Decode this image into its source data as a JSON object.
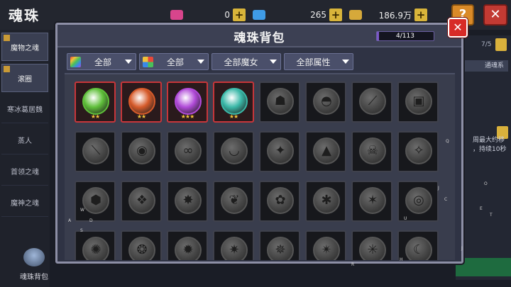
{
  "screen": {
    "title": "魂珠",
    "resources": [
      {
        "name": "pink-gem",
        "value": "0",
        "color": "#d8458c"
      },
      {
        "name": "blue-gem",
        "value": "265",
        "color": "#3f9be6"
      },
      {
        "name": "gold-chest",
        "value": "186.9万",
        "color": "#d6a93a"
      }
    ],
    "help_label": "?",
    "close_label": "✕"
  },
  "sidebar": {
    "items": [
      {
        "label": "魔物之魂",
        "active": true
      },
      {
        "label": "滚圈",
        "active": true
      },
      {
        "label": "寒冰葛居魏",
        "active": false
      },
      {
        "label": "蒸人",
        "active": false
      },
      {
        "label": "首领之魂",
        "active": false
      },
      {
        "label": "魔神之魂",
        "active": false
      }
    ],
    "bag_label": "魂珠背包"
  },
  "right_panel": {
    "count": "7/5",
    "tab": "通魂系",
    "text_line1": "周最大约移",
    "text_line2": "，持续10秒"
  },
  "modal": {
    "title": "魂珠背包",
    "capacity": {
      "text": "4/113",
      "used": 4,
      "total": 113
    },
    "close_label": "✕",
    "filters": [
      {
        "label": "全部",
        "icon": "rainbow-icon"
      },
      {
        "label": "全部",
        "icon": "color-grid-icon"
      },
      {
        "label": "全部魔女",
        "icon": ""
      },
      {
        "label": "全部属性",
        "icon": ""
      }
    ],
    "slots": [
      {
        "owned": true,
        "stars": 2,
        "icon": "green-rune-orb",
        "color": "#5fbf3a"
      },
      {
        "owned": true,
        "stars": 2,
        "icon": "fire-claw-orb",
        "color": "#d65a2a"
      },
      {
        "owned": true,
        "stars": 3,
        "icon": "purple-crystal-orb",
        "color": "#b04ad8"
      },
      {
        "owned": true,
        "stars": 2,
        "icon": "teal-gem-orb",
        "color": "#3ab8a8"
      },
      {
        "owned": false,
        "icon": "mask-orb",
        "glyph": "☗"
      },
      {
        "owned": false,
        "icon": "bird-orb",
        "glyph": "◓"
      },
      {
        "owned": false,
        "icon": "blade-orb",
        "glyph": "⟋"
      },
      {
        "owned": false,
        "icon": "cube-orb",
        "glyph": "▣"
      },
      {
        "owned": false,
        "icon": "sword-orb",
        "glyph": "⟍"
      },
      {
        "owned": false,
        "icon": "dragon-orb",
        "glyph": "◉"
      },
      {
        "owned": false,
        "icon": "serpent-orb",
        "glyph": "∞"
      },
      {
        "owned": false,
        "icon": "wing-orb",
        "glyph": "◡"
      },
      {
        "owned": false,
        "icon": "beast-orb",
        "glyph": "✦"
      },
      {
        "owned": false,
        "icon": "hat-orb",
        "glyph": "▲"
      },
      {
        "owned": false,
        "icon": "skull-orb",
        "glyph": "☠"
      },
      {
        "owned": false,
        "icon": "spear-orb",
        "glyph": "✧"
      },
      {
        "owned": false,
        "icon": "dog-orb",
        "glyph": "⬢"
      },
      {
        "owned": false,
        "icon": "crest-orb",
        "glyph": "❖"
      },
      {
        "owned": false,
        "icon": "spike-orb",
        "glyph": "✸"
      },
      {
        "owned": false,
        "icon": "leaf-orb",
        "glyph": "❦"
      },
      {
        "owned": false,
        "icon": "flower-orb",
        "glyph": "✿"
      },
      {
        "owned": false,
        "icon": "claw-orb",
        "glyph": "✱"
      },
      {
        "owned": false,
        "icon": "wolf-orb",
        "glyph": "✶"
      },
      {
        "owned": false,
        "icon": "ring-orb",
        "glyph": "◎"
      },
      {
        "owned": false,
        "icon": "gear-orb",
        "glyph": "✺"
      },
      {
        "owned": false,
        "icon": "mech-orb",
        "glyph": "❂"
      },
      {
        "owned": false,
        "icon": "bat-orb",
        "glyph": "✹"
      },
      {
        "owned": false,
        "icon": "fish-orb",
        "glyph": "✷"
      },
      {
        "owned": false,
        "icon": "branch-orb",
        "glyph": "✵"
      },
      {
        "owned": false,
        "icon": "talon-orb",
        "glyph": "✴"
      },
      {
        "owned": false,
        "icon": "horn-orb",
        "glyph": "✳"
      },
      {
        "owned": false,
        "icon": "moon-orb",
        "glyph": "☾"
      }
    ]
  },
  "stray_marks": [
    "Q",
    "J",
    "O",
    "W",
    "A",
    "D",
    "S",
    "U",
    "R",
    "H",
    "J",
    "C",
    "E",
    "T"
  ]
}
